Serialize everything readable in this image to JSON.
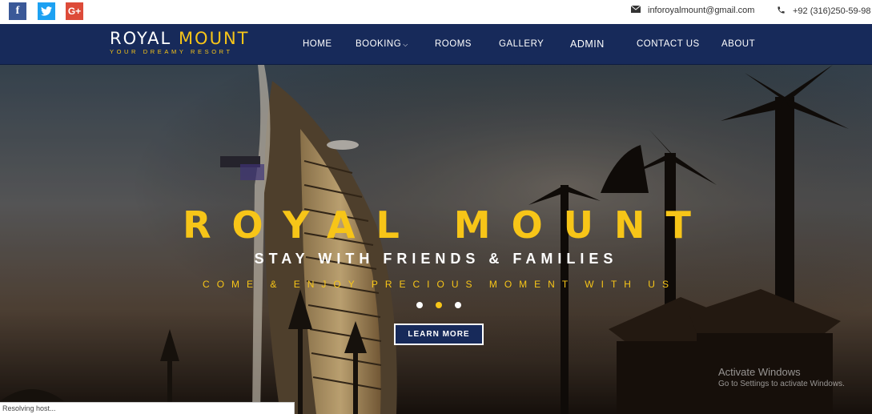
{
  "social": {
    "facebook": "f",
    "twitter": "t",
    "googleplus": "G+"
  },
  "contact": {
    "email": "inforoyalmount@gmail.com",
    "phone": "+92 (316)250-59-98",
    "email_icon": "envelope-icon",
    "phone_icon": "phone-icon"
  },
  "brand": {
    "name_part1": "ROYAL",
    "name_part2": "MOUNT",
    "tagline": "YOUR DREAMY RESORT"
  },
  "nav": {
    "home": "HOME",
    "booking": "BOOKING",
    "rooms": "ROOMS",
    "gallery": "GALLERY",
    "admin": "ADMIN",
    "contact": "CONTACT US",
    "about": "ABOUT"
  },
  "hero": {
    "title": "ROYAL MOUNT",
    "subtitle": "STAY WITH FRIENDS & FAMILIES",
    "tagline": "COME & ENJOY PRECIOUS MOMENT WITH US",
    "button": "LEARN MORE",
    "active_slide": 2,
    "slide_count": 3
  },
  "watermark": {
    "title": "Activate Windows",
    "subtitle": "Go to Settings to activate Windows."
  },
  "status_bar": "Resolving host...",
  "colors": {
    "navy": "#172a5a",
    "gold": "#f7c518"
  }
}
